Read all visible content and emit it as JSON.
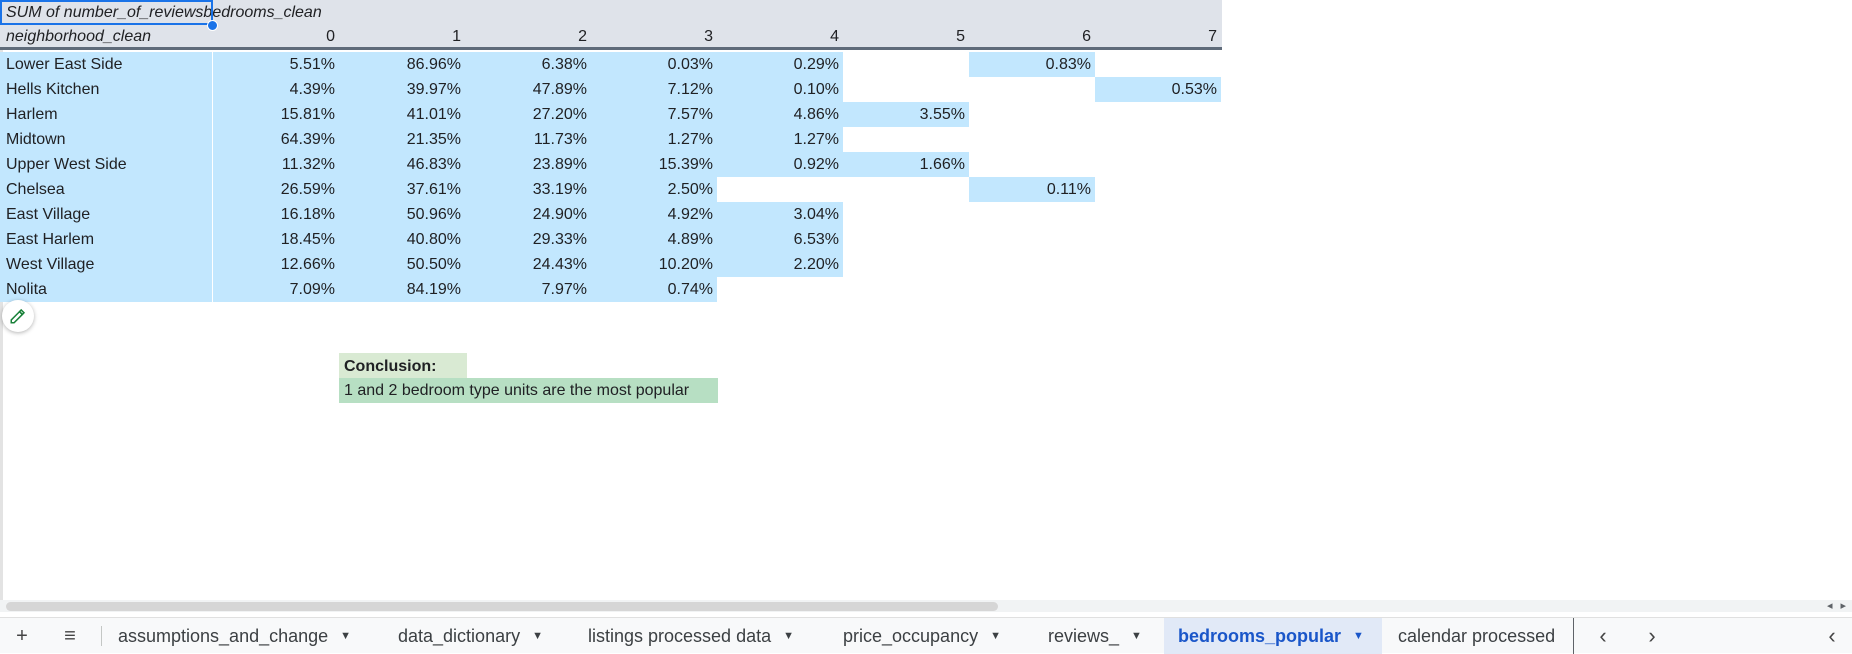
{
  "pivot": {
    "header_label": "SUM of number_of_reviews",
    "column_field": "bedrooms_clean",
    "row_field": "neighborhood_clean",
    "columns": [
      "0",
      "1",
      "2",
      "3",
      "4",
      "5",
      "6",
      "7"
    ],
    "rows": [
      {
        "name": "Lower East Side",
        "values": [
          "5.51%",
          "86.96%",
          "6.38%",
          "0.03%",
          "0.29%",
          "",
          "0.83%",
          ""
        ]
      },
      {
        "name": "Hells Kitchen",
        "values": [
          "4.39%",
          "39.97%",
          "47.89%",
          "7.12%",
          "0.10%",
          "",
          "",
          "0.53%"
        ]
      },
      {
        "name": "Harlem",
        "values": [
          "15.81%",
          "41.01%",
          "27.20%",
          "7.57%",
          "4.86%",
          "3.55%",
          "",
          ""
        ]
      },
      {
        "name": "Midtown",
        "values": [
          "64.39%",
          "21.35%",
          "11.73%",
          "1.27%",
          "1.27%",
          "",
          "",
          ""
        ]
      },
      {
        "name": "Upper West Side",
        "values": [
          "11.32%",
          "46.83%",
          "23.89%",
          "15.39%",
          "0.92%",
          "1.66%",
          "",
          ""
        ]
      },
      {
        "name": "Chelsea",
        "values": [
          "26.59%",
          "37.61%",
          "33.19%",
          "2.50%",
          "",
          "",
          "0.11%",
          ""
        ]
      },
      {
        "name": "East Village",
        "values": [
          "16.18%",
          "50.96%",
          "24.90%",
          "4.92%",
          "3.04%",
          "",
          "",
          ""
        ]
      },
      {
        "name": "East Harlem",
        "values": [
          "18.45%",
          "40.80%",
          "29.33%",
          "4.89%",
          "6.53%",
          "",
          "",
          ""
        ]
      },
      {
        "name": "West Village",
        "values": [
          "12.66%",
          "50.50%",
          "24.43%",
          "10.20%",
          "2.20%",
          "",
          "",
          ""
        ]
      },
      {
        "name": "Nolita",
        "values": [
          "7.09%",
          "84.19%",
          "7.97%",
          "0.74%",
          "",
          "",
          "",
          ""
        ]
      }
    ]
  },
  "conclusion": {
    "title": "Conclusion:",
    "text": "1 and 2 bedroom type units are the most popular"
  },
  "tabs": [
    {
      "label": "assumptions_and_change",
      "active": false
    },
    {
      "label": "data_dictionary",
      "active": false
    },
    {
      "label": "listings processed data",
      "active": false
    },
    {
      "label": "price_occupancy",
      "active": false
    },
    {
      "label": "reviews_",
      "active": false
    },
    {
      "label": "bedrooms_popular",
      "active": true
    },
    {
      "label": "calendar processed",
      "active": false
    }
  ],
  "colors": {
    "cell_highlight": "#c2e7fe",
    "header_bg": "#dfe3ea",
    "active_tab": "#1a56c9",
    "conclusion_title_bg": "#d9ead3",
    "conclusion_text_bg": "#b7dfc3"
  },
  "icons": [
    "add-sheet-icon",
    "all-sheets-icon",
    "edit-pencil-icon",
    "scroll-tabs-left-icon",
    "scroll-tabs-right-icon",
    "collapse-panel-icon"
  ]
}
